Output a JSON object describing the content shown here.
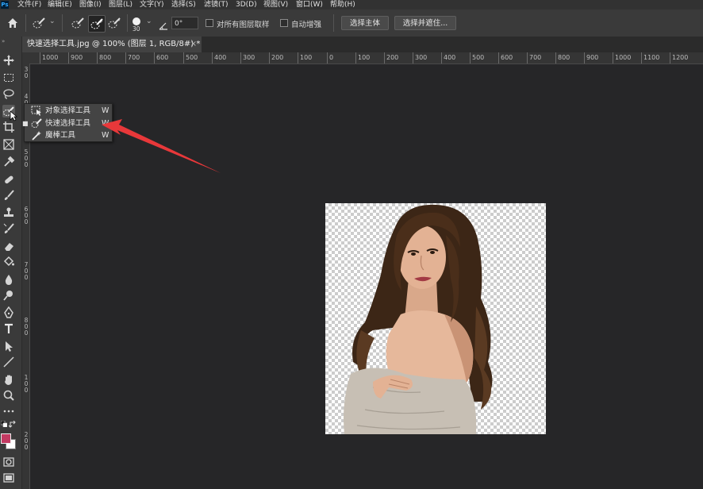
{
  "menubar": {
    "app_logo": "Ps",
    "items": [
      {
        "label": "文件(F)"
      },
      {
        "label": "编辑(E)"
      },
      {
        "label": "图像(I)"
      },
      {
        "label": "图层(L)"
      },
      {
        "label": "文字(Y)"
      },
      {
        "label": "选择(S)"
      },
      {
        "label": "滤镜(T)"
      },
      {
        "label": "3D(D)"
      },
      {
        "label": "视图(V)"
      },
      {
        "label": "窗口(W)"
      },
      {
        "label": "帮助(H)"
      }
    ]
  },
  "options": {
    "brush_size": "30",
    "angle_value": "0°",
    "sample_all_layers": "对所有图层取样",
    "auto_enhance": "自动增强",
    "select_subject": "选择主体",
    "select_and_mask": "选择并遮住..."
  },
  "document": {
    "tab_title": "快速选择工具.jpg @ 100% (图层 1, RGB/8#) *",
    "close_glyph": "×"
  },
  "ruler": {
    "top_ticks": [
      "1000",
      "900",
      "800",
      "700",
      "600",
      "500",
      "400",
      "300",
      "200",
      "100",
      "0",
      "100",
      "200",
      "300",
      "400",
      "500",
      "600",
      "700",
      "800",
      "900",
      "1000",
      "1100",
      "1200"
    ],
    "left_ticks": [
      "3",
      "0",
      "4",
      "0",
      "0",
      "5",
      "0",
      "0",
      "6",
      "0",
      "0",
      "7",
      "0",
      "0",
      "8",
      "0",
      "0",
      "1",
      "0",
      "0",
      "2",
      "0",
      "0"
    ]
  },
  "flyout": {
    "items": [
      {
        "label": "对象选择工具",
        "shortcut": "W",
        "icon": "object-selection-icon",
        "active": false
      },
      {
        "label": "快速选择工具",
        "shortcut": "W",
        "icon": "quick-selection-icon",
        "active": true
      },
      {
        "label": "魔棒工具",
        "shortcut": "W",
        "icon": "magic-wand-icon",
        "active": false
      }
    ]
  },
  "colors": {
    "foreground": "#c23a62",
    "background": "#ffffff",
    "annotation_arrow": "#e8383a"
  }
}
